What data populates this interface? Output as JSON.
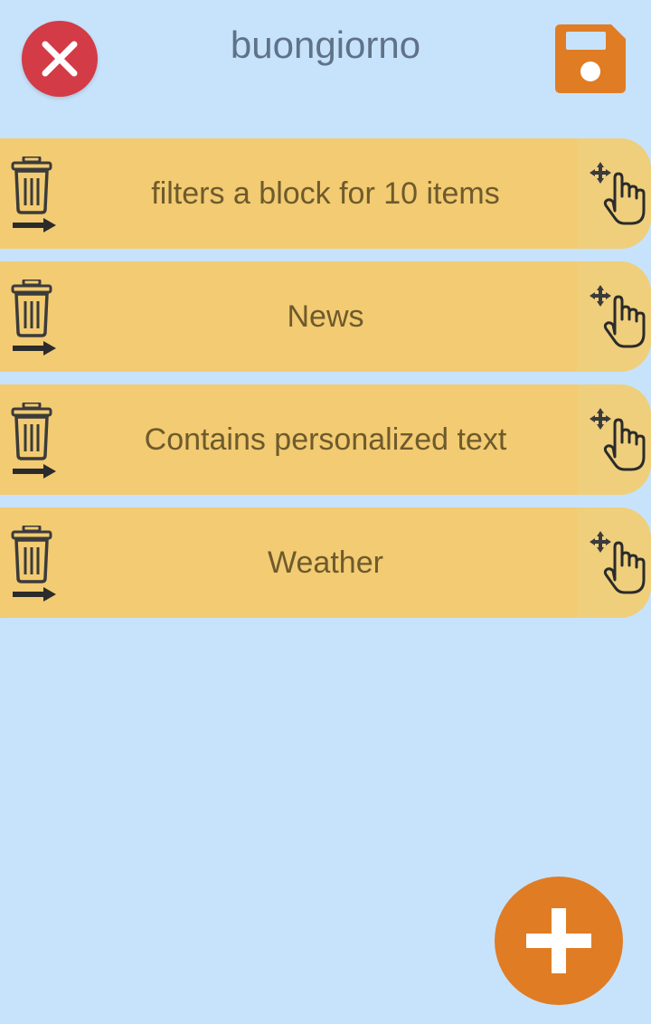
{
  "header": {
    "title": "buongiorno",
    "close_icon": "close-icon",
    "save_icon": "floppy-disk-icon"
  },
  "blocks": [
    {
      "label": "filters a block for 10 items",
      "delete_icon": "trash-arrow-icon",
      "drag_icon": "drag-hand-icon"
    },
    {
      "label": "News",
      "delete_icon": "trash-arrow-icon",
      "drag_icon": "drag-hand-icon"
    },
    {
      "label": "Contains personalized text",
      "delete_icon": "trash-arrow-icon",
      "drag_icon": "drag-hand-icon"
    },
    {
      "label": "Weather",
      "delete_icon": "trash-arrow-icon",
      "drag_icon": "drag-hand-icon"
    }
  ],
  "fab": {
    "icon": "plus-icon"
  },
  "colors": {
    "background": "#c7e3fb",
    "block": "#f2cb72",
    "close": "#d33b46",
    "accent": "#e07c24",
    "title": "#5f7288"
  }
}
